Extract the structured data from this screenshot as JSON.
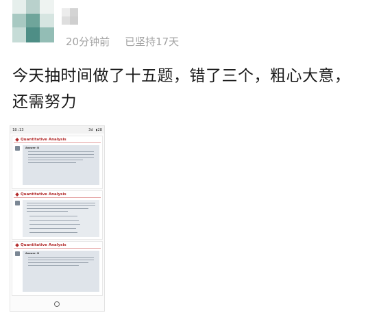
{
  "post": {
    "timestamp": "20分钟前",
    "streak": "已坚持17天",
    "text_line1": "今天抽时间做了十五题，错了三个，粗心大意，",
    "text_line2": "还需努力"
  },
  "phone": {
    "status_time": "18:13",
    "status_right": "3d",
    "status_battery": "28",
    "panels": [
      {
        "title": "Quantitative Analysis",
        "answer": "Answer: B"
      },
      {
        "title": "Quantitative Analysis"
      },
      {
        "title": "Quantitative Analysis",
        "answer": "Answer: B"
      }
    ]
  },
  "colors": {
    "accent": "#b22b2b",
    "meta": "#a3a3a3",
    "card": "#dfe4ea"
  }
}
